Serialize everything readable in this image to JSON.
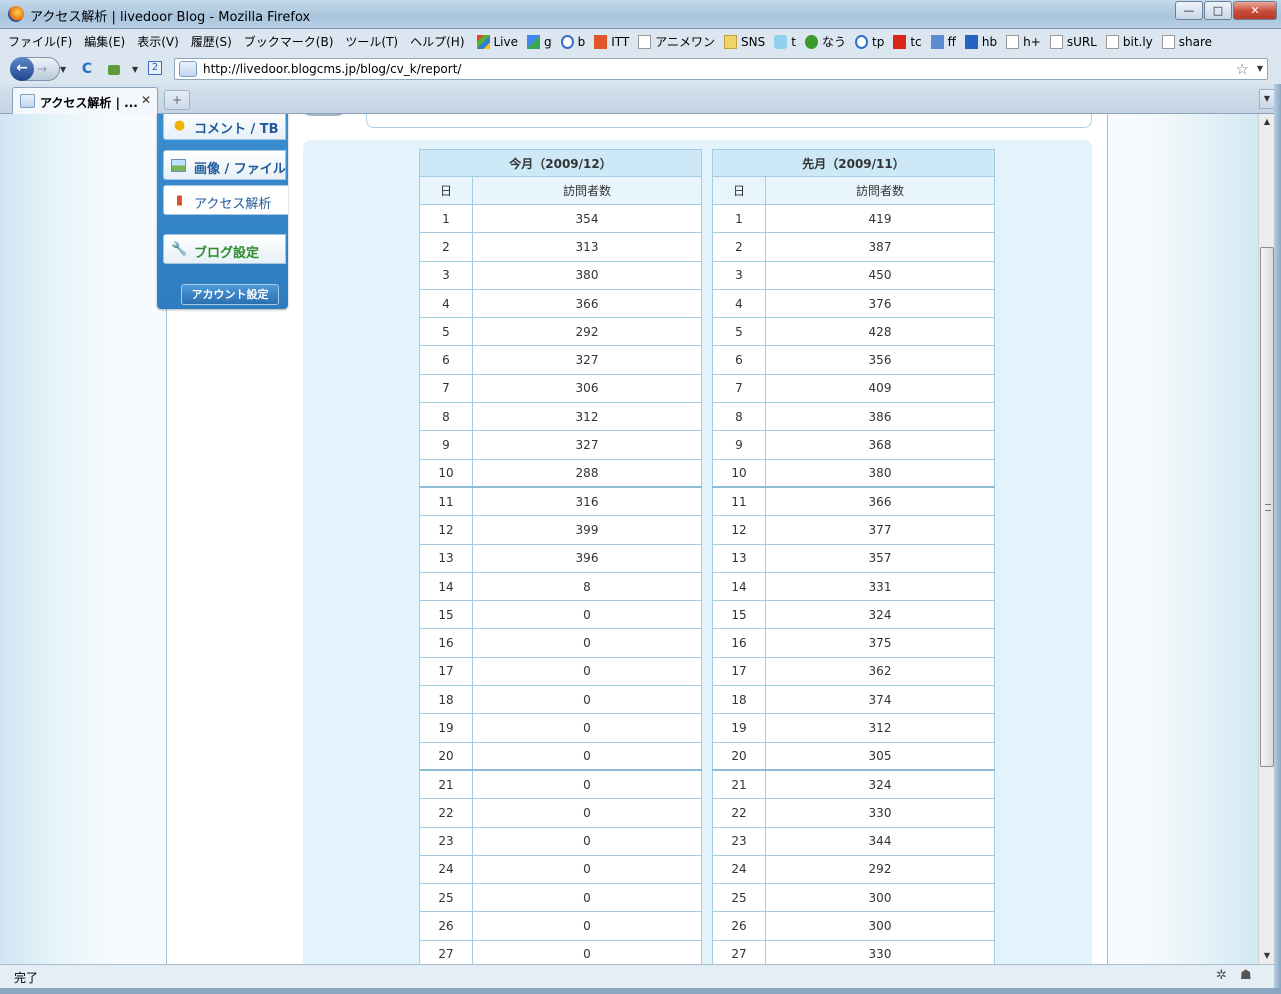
{
  "window": {
    "title": "アクセス解析 | livedoor Blog - Mozilla Firefox",
    "minimize": "—",
    "maximize": "□",
    "close": "✕"
  },
  "menu": [
    "ファイル(F)",
    "編集(E)",
    "表示(V)",
    "履歴(S)",
    "ブックマーク(B)",
    "ツール(T)",
    "ヘルプ(H)"
  ],
  "bookmarks": [
    "Live",
    "g",
    "b",
    "ITT",
    "アニメワン",
    "SNS",
    "t",
    "なう",
    "tp",
    "tc",
    "ff",
    "hb",
    "h+",
    "sURL",
    "bit.ly",
    "share"
  ],
  "nav": {
    "url": "http://livedoor.blogcms.jp/blog/cv_k/report/",
    "back": "←",
    "forward": "→",
    "reload": "C",
    "home_icon": "home-icon",
    "star": "☆"
  },
  "tabs": [
    {
      "label": "アクセス解析 | ...",
      "close": "✕"
    }
  ],
  "newtab": "+",
  "sidebar": {
    "items": [
      {
        "label": "コメント / TB",
        "icon": "comment-icon"
      },
      {
        "label": "画像 / ファイル",
        "icon": "image-icon"
      },
      {
        "label": "アクセス解析",
        "icon": "chart-icon"
      },
      {
        "label": "ブログ設定",
        "icon": "wrench-icon"
      }
    ],
    "account": "アカウント設定"
  },
  "report": {
    "current": {
      "title": "今月（2009/12）",
      "col_day": "日",
      "col_visitors": "訪問者数",
      "rows": [
        [
          "1",
          "354"
        ],
        [
          "2",
          "313"
        ],
        [
          "3",
          "380"
        ],
        [
          "4",
          "366"
        ],
        [
          "5",
          "292"
        ],
        [
          "6",
          "327"
        ],
        [
          "7",
          "306"
        ],
        [
          "8",
          "312"
        ],
        [
          "9",
          "327"
        ],
        [
          "10",
          "288"
        ],
        [
          "11",
          "316"
        ],
        [
          "12",
          "399"
        ],
        [
          "13",
          "396"
        ],
        [
          "14",
          "8"
        ],
        [
          "15",
          "0"
        ],
        [
          "16",
          "0"
        ],
        [
          "17",
          "0"
        ],
        [
          "18",
          "0"
        ],
        [
          "19",
          "0"
        ],
        [
          "20",
          "0"
        ],
        [
          "21",
          "0"
        ],
        [
          "22",
          "0"
        ],
        [
          "23",
          "0"
        ],
        [
          "24",
          "0"
        ],
        [
          "25",
          "0"
        ],
        [
          "26",
          "0"
        ],
        [
          "27",
          "0"
        ]
      ]
    },
    "previous": {
      "title": "先月（2009/11）",
      "col_day": "日",
      "col_visitors": "訪問者数",
      "rows": [
        [
          "1",
          "419"
        ],
        [
          "2",
          "387"
        ],
        [
          "3",
          "450"
        ],
        [
          "4",
          "376"
        ],
        [
          "5",
          "428"
        ],
        [
          "6",
          "356"
        ],
        [
          "7",
          "409"
        ],
        [
          "8",
          "386"
        ],
        [
          "9",
          "368"
        ],
        [
          "10",
          "380"
        ],
        [
          "11",
          "366"
        ],
        [
          "12",
          "377"
        ],
        [
          "13",
          "357"
        ],
        [
          "14",
          "331"
        ],
        [
          "15",
          "324"
        ],
        [
          "16",
          "375"
        ],
        [
          "17",
          "362"
        ],
        [
          "18",
          "374"
        ],
        [
          "19",
          "312"
        ],
        [
          "20",
          "305"
        ],
        [
          "21",
          "324"
        ],
        [
          "22",
          "330"
        ],
        [
          "23",
          "344"
        ],
        [
          "24",
          "292"
        ],
        [
          "25",
          "300"
        ],
        [
          "26",
          "300"
        ],
        [
          "27",
          "330"
        ]
      ]
    }
  },
  "status": {
    "text": "完了"
  },
  "colors": {
    "accent": "#2e7dc0",
    "table_border": "#a4cde3",
    "table_header": "#cde9f8"
  }
}
